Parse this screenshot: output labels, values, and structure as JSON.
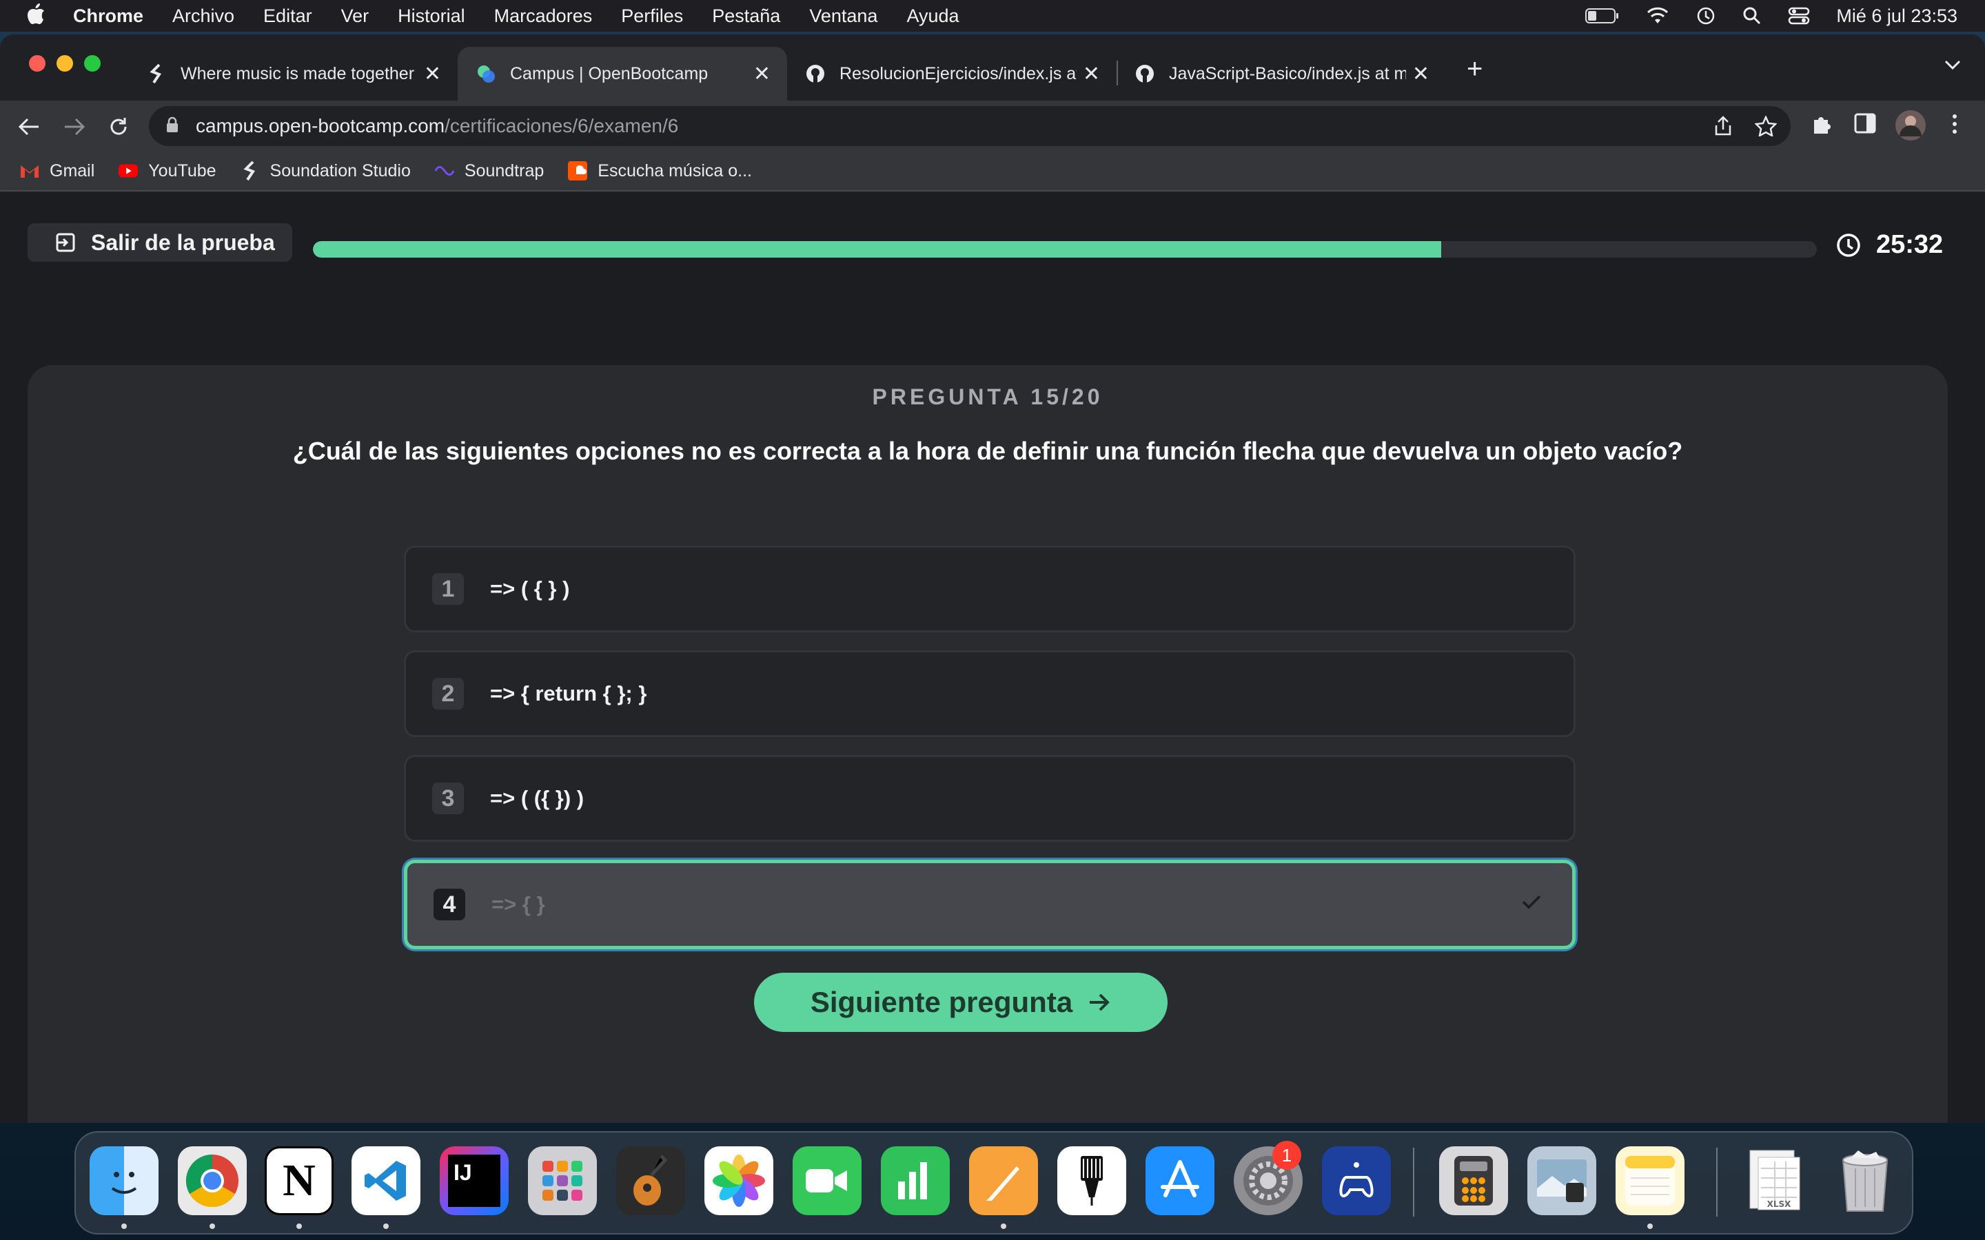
{
  "menubar": {
    "app_name": "Chrome",
    "menus": [
      "Archivo",
      "Editar",
      "Ver",
      "Historial",
      "Marcadores",
      "Perfiles",
      "Pestaña",
      "Ventana",
      "Ayuda"
    ],
    "clock": "Mié 6 jul  23:53"
  },
  "browser": {
    "tabs": [
      {
        "title": "Where music is made together",
        "icon": "soundation-icon"
      },
      {
        "title": "Campus | OpenBootcamp",
        "icon": "openbootcamp-icon"
      },
      {
        "title": "ResolucionEjercicios/index.js at m",
        "icon": "github-icon"
      },
      {
        "title": "JavaScript-Basico/index.js at m",
        "icon": "github-icon"
      }
    ],
    "active_tab": 1,
    "url_host": "campus.open-bootcamp.com",
    "url_path": "/certificaciones/6/examen/6",
    "bookmarks": [
      {
        "label": "Gmail",
        "icon": "gmail-icon"
      },
      {
        "label": "YouTube",
        "icon": "youtube-icon"
      },
      {
        "label": "Soundation Studio",
        "icon": "soundation-icon"
      },
      {
        "label": "Soundtrap",
        "icon": "soundtrap-icon"
      },
      {
        "label": "Escucha música o...",
        "icon": "soundcloud-icon"
      }
    ]
  },
  "exam": {
    "exit_label": "Salir de la prueba",
    "progress_fraction": 0.75,
    "timer": "25:32",
    "question_counter": "PREGUNTA 15/20",
    "question": "¿Cuál de las siguientes opciones no es correcta a la hora de definir una función flecha que devuelva un objeto vacío?",
    "options": [
      {
        "number": "1",
        "text": "=> ( { } )",
        "selected": false
      },
      {
        "number": "2",
        "text": "=> { return { }; }",
        "selected": false
      },
      {
        "number": "3",
        "text": "=> ( ({ }) )",
        "selected": false
      },
      {
        "number": "4",
        "text": "=> { }",
        "selected": true
      }
    ],
    "next_label": "Siguiente pregunta"
  },
  "dock": {
    "apps": [
      "finder",
      "chrome",
      "notion",
      "vscode",
      "intellij",
      "launchpad",
      "garageband",
      "photos",
      "facetime",
      "numbers",
      "pages",
      "ink",
      "app-store",
      "system-preferences",
      "game-controller",
      "calculator",
      "preview",
      "notes",
      "xlsx-file",
      "trash"
    ],
    "badge": "1"
  },
  "colors": {
    "accent": "#5dd39e",
    "page_bg": "#1c1d21",
    "card_bg": "#2a2b2f"
  }
}
